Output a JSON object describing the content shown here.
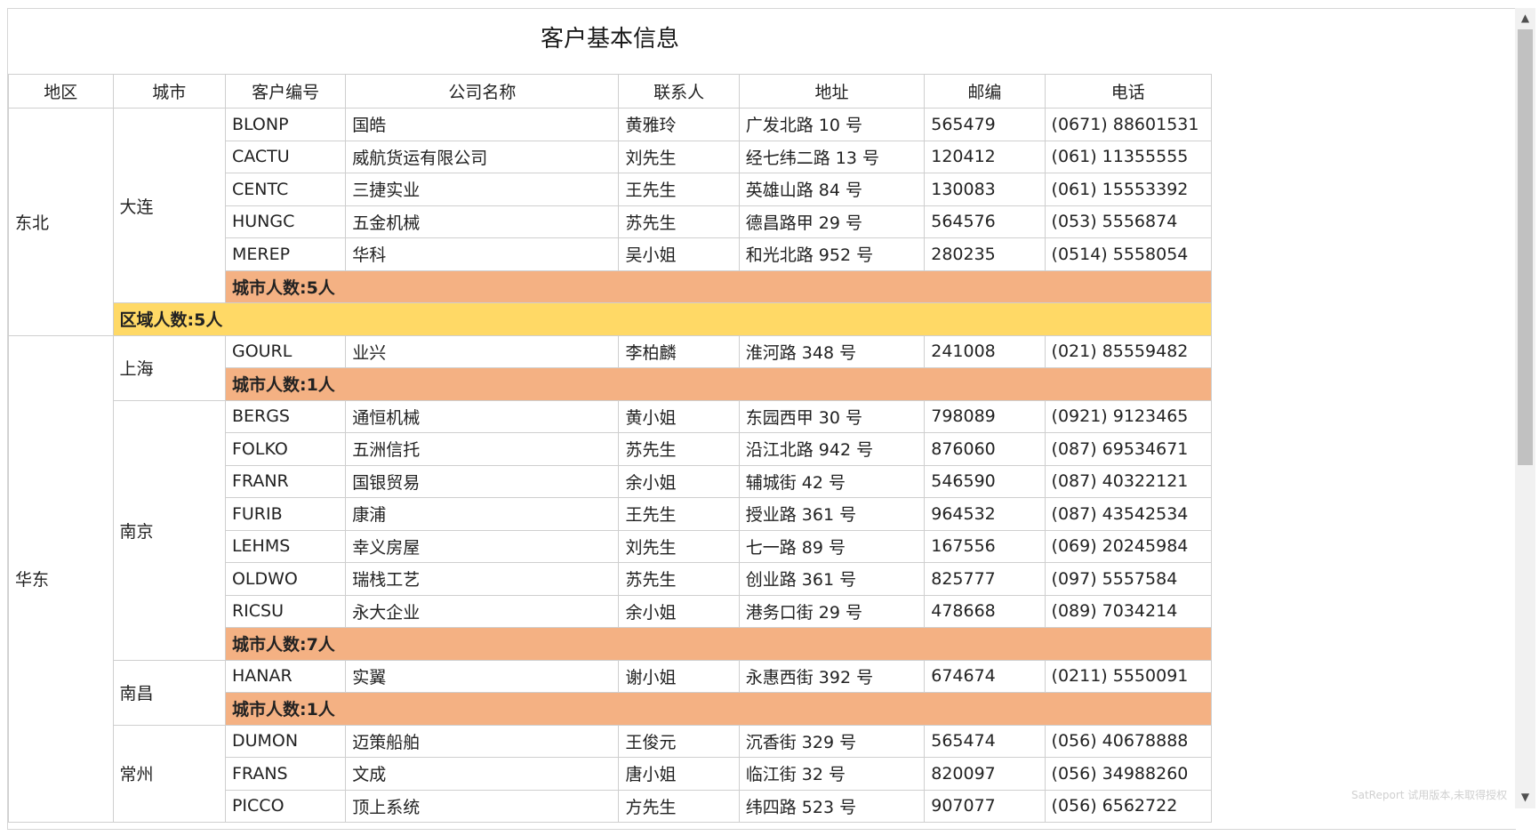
{
  "report": {
    "title": "客户基本信息",
    "headers": [
      "地区",
      "城市",
      "客户编号",
      "公司名称",
      "联系人",
      "地址",
      "邮编",
      "电话"
    ],
    "regions": [
      {
        "name": "东北",
        "region_summary": "区域人数:5人",
        "cities": [
          {
            "name": "大连",
            "summary": "城市人数:5人",
            "rows": [
              [
                "BLONP",
                "国皓",
                "黄雅玲",
                "广发北路 10 号",
                "565479",
                "(0671) 88601531"
              ],
              [
                "CACTU",
                "威航货运有限公司",
                "刘先生",
                "经七纬二路 13 号",
                "120412",
                "(061) 11355555"
              ],
              [
                "CENTC",
                "三捷实业",
                "王先生",
                "英雄山路 84 号",
                "130083",
                "(061) 15553392"
              ],
              [
                "HUNGC",
                "五金机械",
                "苏先生",
                "德昌路甲 29 号",
                "564576",
                "(053) 5556874"
              ],
              [
                "MEREP",
                "华科",
                "吴小姐",
                "和光北路 952 号",
                "280235",
                "(0514) 5558054"
              ]
            ]
          }
        ]
      },
      {
        "name": "华东",
        "cities": [
          {
            "name": "上海",
            "summary": "城市人数:1人",
            "rows": [
              [
                "GOURL",
                "业兴",
                "李柏麟",
                "淮河路 348 号",
                "241008",
                "(021) 85559482"
              ]
            ]
          },
          {
            "name": "南京",
            "summary": "城市人数:7人",
            "rows": [
              [
                "BERGS",
                "通恒机械",
                "黄小姐",
                "东园西甲 30 号",
                "798089",
                "(0921) 9123465"
              ],
              [
                "FOLKO",
                "五洲信托",
                "苏先生",
                "沿江北路 942 号",
                "876060",
                "(087) 69534671"
              ],
              [
                "FRANR",
                "国银贸易",
                "余小姐",
                "辅城街 42 号",
                "546590",
                "(087) 40322121"
              ],
              [
                "FURIB",
                "康浦",
                "王先生",
                "授业路 361 号",
                "964532",
                "(087) 43542534"
              ],
              [
                "LEHMS",
                "幸义房屋",
                "刘先生",
                "七一路 89 号",
                "167556",
                "(069) 20245984"
              ],
              [
                "OLDWO",
                "瑞栈工艺",
                "苏先生",
                "创业路 361 号",
                "825777",
                "(097) 5557584"
              ],
              [
                "RICSU",
                "永大企业",
                "余小姐",
                "港务口街 29 号",
                "478668",
                "(089) 7034214"
              ]
            ]
          },
          {
            "name": "南昌",
            "summary": "城市人数:1人",
            "rows": [
              [
                "HANAR",
                "实翼",
                "谢小姐",
                "永惠西街 392 号",
                "674674",
                "(0211) 5550091"
              ]
            ]
          },
          {
            "name": "常州",
            "rows": [
              [
                "DUMON",
                "迈策船舶",
                "王俊元",
                "沉香街 329 号",
                "565474",
                "(056) 40678888"
              ],
              [
                "FRANS",
                "文成",
                "唐小姐",
                "临江街 32 号",
                "820097",
                "(056) 34988260"
              ],
              [
                "PICCO",
                "顶上系统",
                "方先生",
                "纬四路 523 号",
                "907077",
                "(056) 6562722"
              ]
            ]
          }
        ]
      }
    ]
  },
  "watermark": "SatReport 试用版本,未取得授权",
  "scrollbar": {
    "up_icon": "▲",
    "down_icon": "▼"
  }
}
